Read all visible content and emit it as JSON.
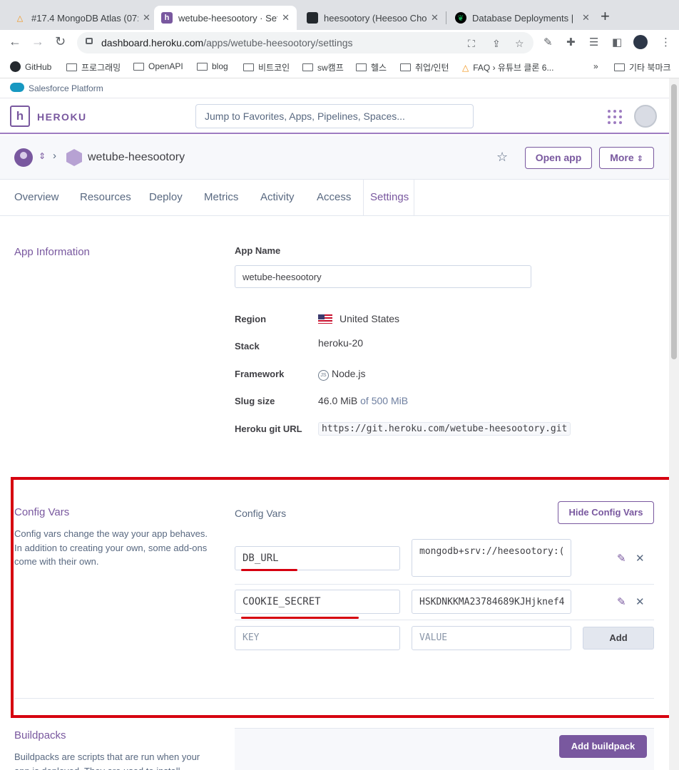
{
  "browser": {
    "tabs": [
      {
        "title": "#17.4 MongoDB Atlas (07:",
        "icon": "warning-triangle-icon"
      },
      {
        "title": "wetube-heesootory · Set",
        "icon": "heroku-icon"
      },
      {
        "title": "heesootory (Heesoo Cho",
        "icon": "github-icon"
      },
      {
        "title": "Database Deployments |",
        "icon": "mongodb-leaf-icon"
      }
    ],
    "url_host": "dashboard.heroku.com",
    "url_path": "/apps/wetube-heesootory/settings",
    "bookmarks": [
      "GitHub",
      "프로그래밍",
      "OpenAPI",
      "blog",
      "비트코인",
      "sw캠프",
      "헬스",
      "취업/인턴",
      "FAQ › 유튜브 클론 6...",
      "기타 북마크"
    ],
    "overflow_label": "»"
  },
  "salesforce": {
    "label": "Salesforce Platform"
  },
  "heroku": {
    "brand": "HEROKU",
    "search_placeholder": "Jump to Favorites, Apps, Pipelines, Spaces..."
  },
  "app": {
    "name": "wetube-heesootory",
    "open_app": "Open app",
    "more": "More"
  },
  "tabs": [
    "Overview",
    "Resources",
    "Deploy",
    "Metrics",
    "Activity",
    "Access",
    "Settings"
  ],
  "active_tab": "Settings",
  "app_info": {
    "section_title": "App Information",
    "app_name_label": "App Name",
    "app_name_value": "wetube-heesootory",
    "region_label": "Region",
    "region_value": "United States",
    "stack_label": "Stack",
    "stack_value": "heroku-20",
    "framework_label": "Framework",
    "framework_value": "Node.js",
    "slug_label": "Slug size",
    "slug_value": "46.0 MiB",
    "slug_of": "of 500 MiB",
    "git_label": "Heroku git URL",
    "git_value": "https://git.heroku.com/wetube-heesootory.git"
  },
  "config_vars": {
    "section_title": "Config Vars",
    "description": "Config vars change the way your app behaves. In addition to creating your own, some add-ons come with their own.",
    "subtitle": "Config Vars",
    "hide_button": "Hide Config Vars",
    "vars": [
      {
        "key": "DB_URL",
        "value": "mongodb+srv://heesootory:("
      },
      {
        "key": "COOKIE_SECRET",
        "value": "HSKDNKKMA23784689KJHjknef4"
      }
    ],
    "key_placeholder": "KEY",
    "value_placeholder": "VALUE",
    "add_button": "Add"
  },
  "buildpacks": {
    "section_title": "Buildpacks",
    "description": "Buildpacks are scripts that are run when your app is deployed. They are used to install",
    "add_button": "Add buildpack"
  },
  "colors": {
    "heroku_purple": "#79589f",
    "highlight_red": "#d6000f"
  }
}
